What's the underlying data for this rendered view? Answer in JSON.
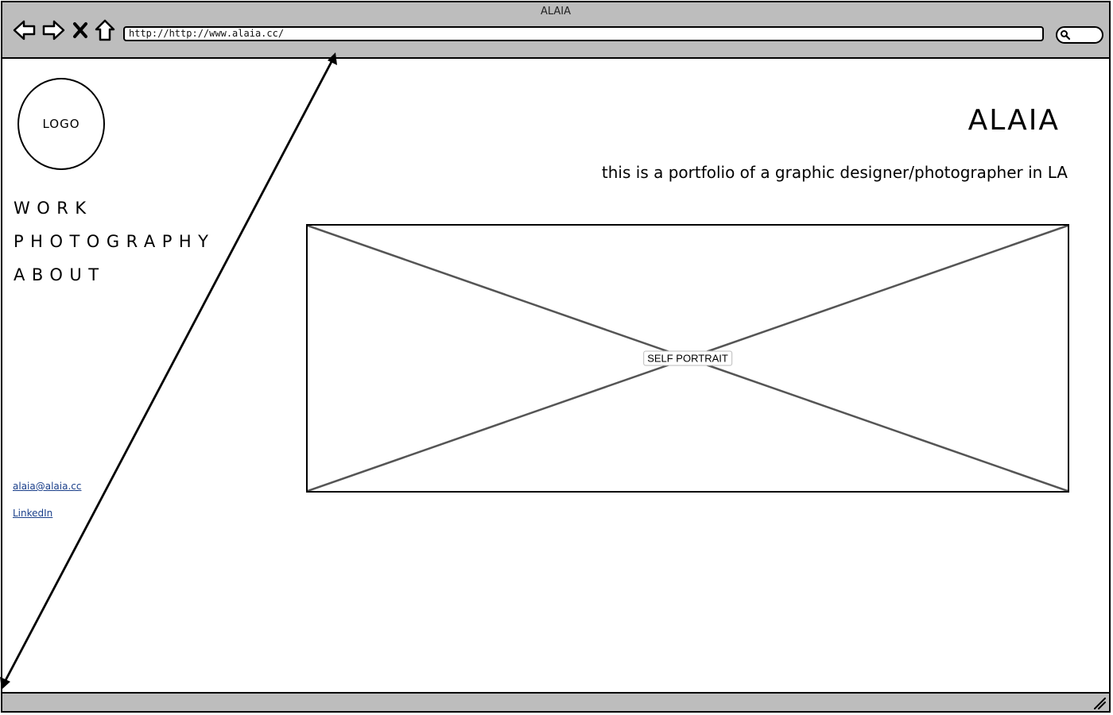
{
  "window": {
    "title": "ALAIA",
    "address": "http://http://www.alaia.cc/"
  },
  "toolbar": {
    "icons": [
      "back-arrow-icon",
      "forward-arrow-icon",
      "stop-x-icon",
      "home-icon",
      "search-icon",
      "resize-grip-icon"
    ]
  },
  "sidebar": {
    "logo_text": "LOGO",
    "nav": [
      {
        "label": "WORK"
      },
      {
        "label": "PHOTOGRAPHY"
      },
      {
        "label": "ABOUT"
      }
    ],
    "contact": {
      "email": "alaia@alaia.cc",
      "linkedin": "LinkedIn"
    }
  },
  "main": {
    "title": "ALAIA",
    "tagline": "this is a portfolio of a graphic designer/photographer in LA",
    "image_label": "SELF PORTRAIT"
  }
}
